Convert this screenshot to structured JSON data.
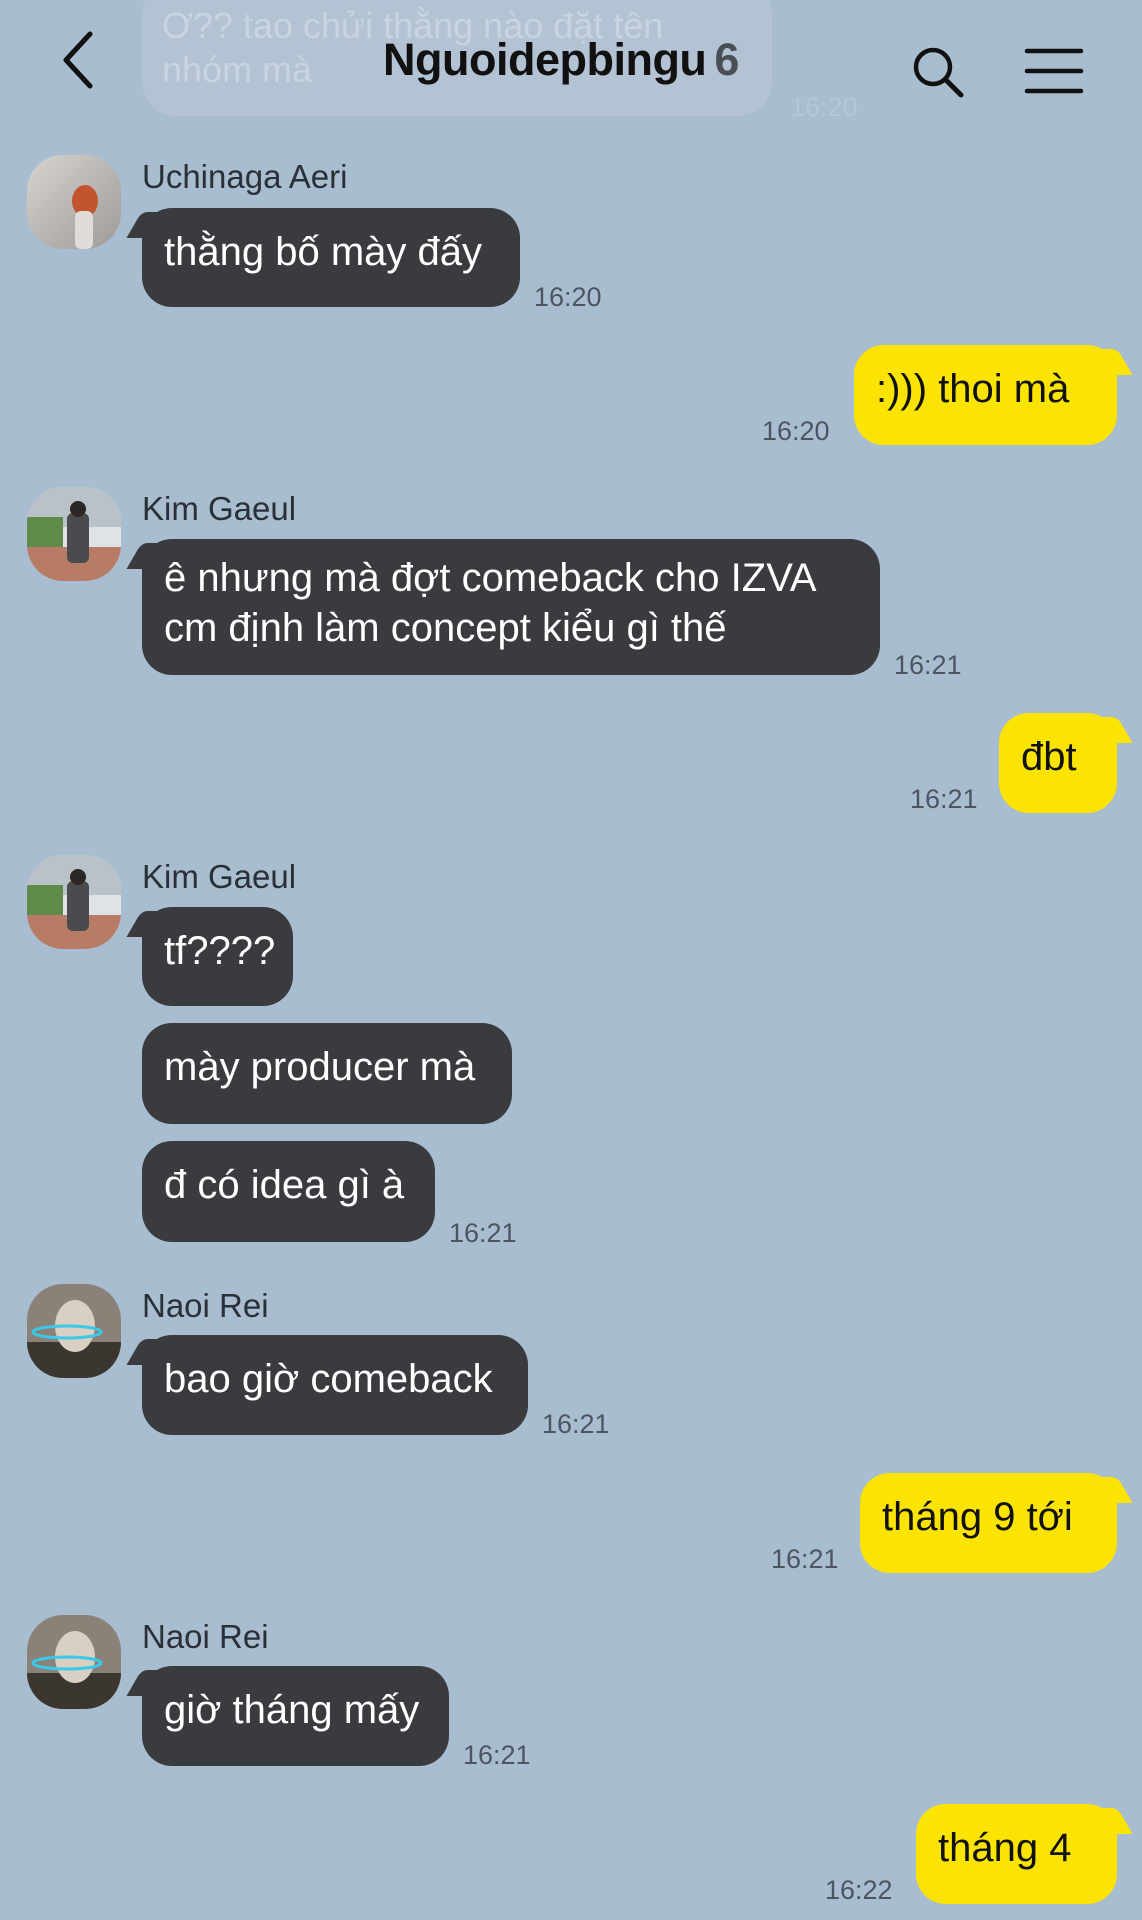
{
  "header": {
    "title": "Nguoidepbingu",
    "member_count": "6",
    "faded_prev_message": "Ơ?? tao chửi thằng nào đặt tên nhóm mà",
    "faded_prev_time": "16:20"
  },
  "messages": [
    {
      "sender": "Uchinaga Aeri",
      "text": "thằng bố mày đấy",
      "time": "16:20"
    },
    {
      "sender": "me",
      "text": ":))) thoi mà",
      "time": "16:20"
    },
    {
      "sender": "Kim Gaeul",
      "text": "ê nhưng mà đợt comeback cho IZVA cm định làm concept kiểu gì thế",
      "time": "16:21"
    },
    {
      "sender": "me",
      "text": "đbt",
      "time": "16:21"
    },
    {
      "sender": "Kim Gaeul",
      "text": "tf????",
      "time": ""
    },
    {
      "sender": "Kim Gaeul",
      "text": "mày producer mà",
      "time": ""
    },
    {
      "sender": "Kim Gaeul",
      "text": "đ có idea gì à",
      "time": "16:21"
    },
    {
      "sender": "Naoi Rei",
      "text": "bao giờ comeback",
      "time": "16:21"
    },
    {
      "sender": "me",
      "text": "tháng 9 tới",
      "time": "16:21"
    },
    {
      "sender": "Naoi Rei",
      "text": "giờ tháng mấy",
      "time": "16:21"
    },
    {
      "sender": "me",
      "text": "tháng 4",
      "time": "16:22"
    }
  ],
  "avatars": [
    {
      "name": "Uchinaga Aeri",
      "icon": "avatar-photo"
    },
    {
      "name": "Kim Gaeul",
      "icon": "avatar-photo"
    },
    {
      "name": "Kim Gaeul",
      "icon": "avatar-photo"
    },
    {
      "name": "Naoi Rei",
      "icon": "avatar-photo"
    },
    {
      "name": "Naoi Rei",
      "icon": "avatar-photo"
    }
  ],
  "colors": {
    "background": "#a9bdd1",
    "other_bubble": "#3a3b3f",
    "my_bubble": "#fbe404"
  }
}
